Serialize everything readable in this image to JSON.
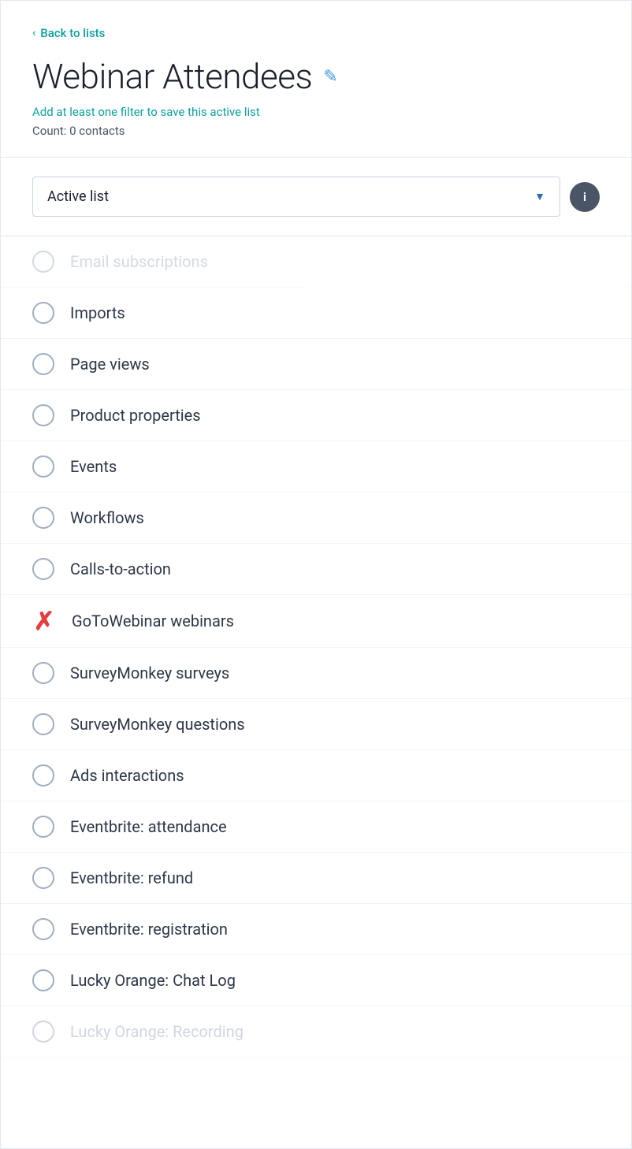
{
  "header": {
    "back_label": "Back to lists",
    "title": "Webinar Attendees",
    "subtitle": "Add at least one filter to save this active list",
    "count": "Count: 0 contacts",
    "edit_icon": "✎"
  },
  "dropdown": {
    "selected": "Active list",
    "info_label": "i"
  },
  "list_items": [
    {
      "id": "email-subscriptions",
      "label": "Email subscriptions",
      "state": "unchecked",
      "faded": true
    },
    {
      "id": "imports",
      "label": "Imports",
      "state": "unchecked",
      "faded": false
    },
    {
      "id": "page-views",
      "label": "Page views",
      "state": "unchecked",
      "faded": false
    },
    {
      "id": "product-properties",
      "label": "Product properties",
      "state": "unchecked",
      "faded": false
    },
    {
      "id": "events",
      "label": "Events",
      "state": "unchecked",
      "faded": false
    },
    {
      "id": "workflows",
      "label": "Workflows",
      "state": "unchecked",
      "faded": false
    },
    {
      "id": "calls-to-action",
      "label": "Calls-to-action",
      "state": "unchecked",
      "faded": false
    },
    {
      "id": "gotowebinar-webinars",
      "label": "GoToWebinar webinars",
      "state": "checked-x",
      "faded": false
    },
    {
      "id": "surveymonkey-surveys",
      "label": "SurveyMonkey surveys",
      "state": "unchecked",
      "faded": false
    },
    {
      "id": "surveymonkey-questions",
      "label": "SurveyMonkey questions",
      "state": "unchecked",
      "faded": false
    },
    {
      "id": "ads-interactions",
      "label": "Ads interactions",
      "state": "unchecked",
      "faded": false
    },
    {
      "id": "eventbrite-attendance",
      "label": "Eventbrite: attendance",
      "state": "unchecked",
      "faded": false
    },
    {
      "id": "eventbrite-refund",
      "label": "Eventbrite: refund",
      "state": "unchecked",
      "faded": false
    },
    {
      "id": "eventbrite-registration",
      "label": "Eventbrite: registration",
      "state": "unchecked",
      "faded": false
    },
    {
      "id": "lucky-orange-chat-log",
      "label": "Lucky Orange: Chat Log",
      "state": "unchecked",
      "faded": false
    },
    {
      "id": "lucky-orange-recording",
      "label": "Lucky Orange: Recording",
      "state": "unchecked",
      "faded": true
    }
  ],
  "colors": {
    "teal": "#0f9f9f",
    "blue": "#2b6cb0",
    "red": "#e53e3e",
    "gray_border": "#cbd5e0"
  }
}
